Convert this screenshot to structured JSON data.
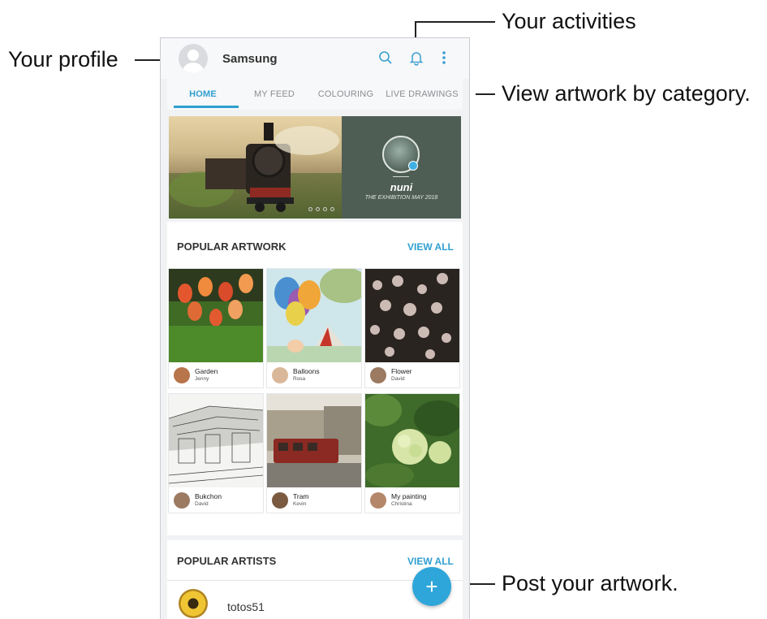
{
  "callouts": {
    "profile": "Your profile",
    "activities": "Your activities",
    "category": "View artwork by category.",
    "post": "Post your artwork."
  },
  "topbar": {
    "username": "Samsung"
  },
  "tabs": [
    "HOME",
    "MY FEED",
    "COLOURING",
    "LIVE DRAWINGS"
  ],
  "banner": {
    "name": "nuni",
    "subtitle": "THE EXHIBITION MAY 2018"
  },
  "popular_artwork": {
    "title": "POPULAR ARTWORK",
    "view_all": "VIEW ALL",
    "items": [
      {
        "title": "Garden",
        "author": "Jenny"
      },
      {
        "title": "Balloons",
        "author": "Rosa"
      },
      {
        "title": "Flower",
        "author": "David"
      },
      {
        "title": "Bukchon",
        "author": "David"
      },
      {
        "title": "Tram",
        "author": "Kevin"
      },
      {
        "title": "My painting",
        "author": "Christina"
      }
    ]
  },
  "popular_artists": {
    "title": "POPULAR ARTISTS",
    "view_all": "VIEW ALL",
    "first_artist": "totos51"
  },
  "colors": {
    "accent": "#2f9fd0",
    "fab": "#2fa6d9"
  }
}
